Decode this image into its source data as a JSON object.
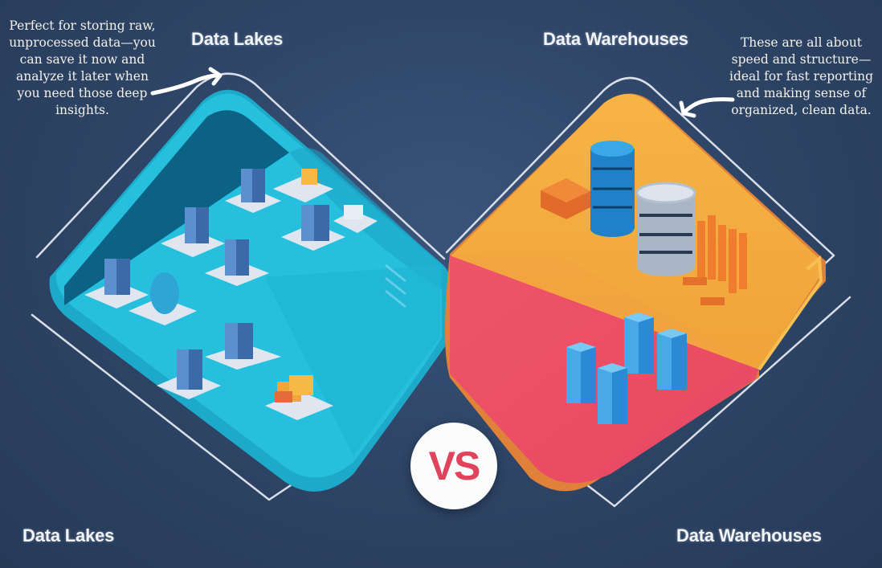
{
  "infographic": {
    "left_panel": {
      "title_top": "Data Lakes",
      "title_bottom": "Data Lakes",
      "annotation": "Perfect for storing raw, unprocessed data—you can save it now and analyze it later when you need those deep insights.",
      "theme_color": "#25c2df",
      "illustration": "isometric-office-buildings-icon"
    },
    "right_panel": {
      "title_top": "Data Warehouses",
      "title_bottom": "Data Warehouses",
      "annotation": "These are all about speed and structure—ideal for fast reporting and making sense of organized, clean data.",
      "theme_colors": {
        "top": "#f4aa3c",
        "bottom": "#ee5366"
      },
      "illustration": "database-cylinders-and-buildings-icon"
    },
    "center_badge": {
      "label": "VS",
      "color": "#e0435b"
    }
  }
}
